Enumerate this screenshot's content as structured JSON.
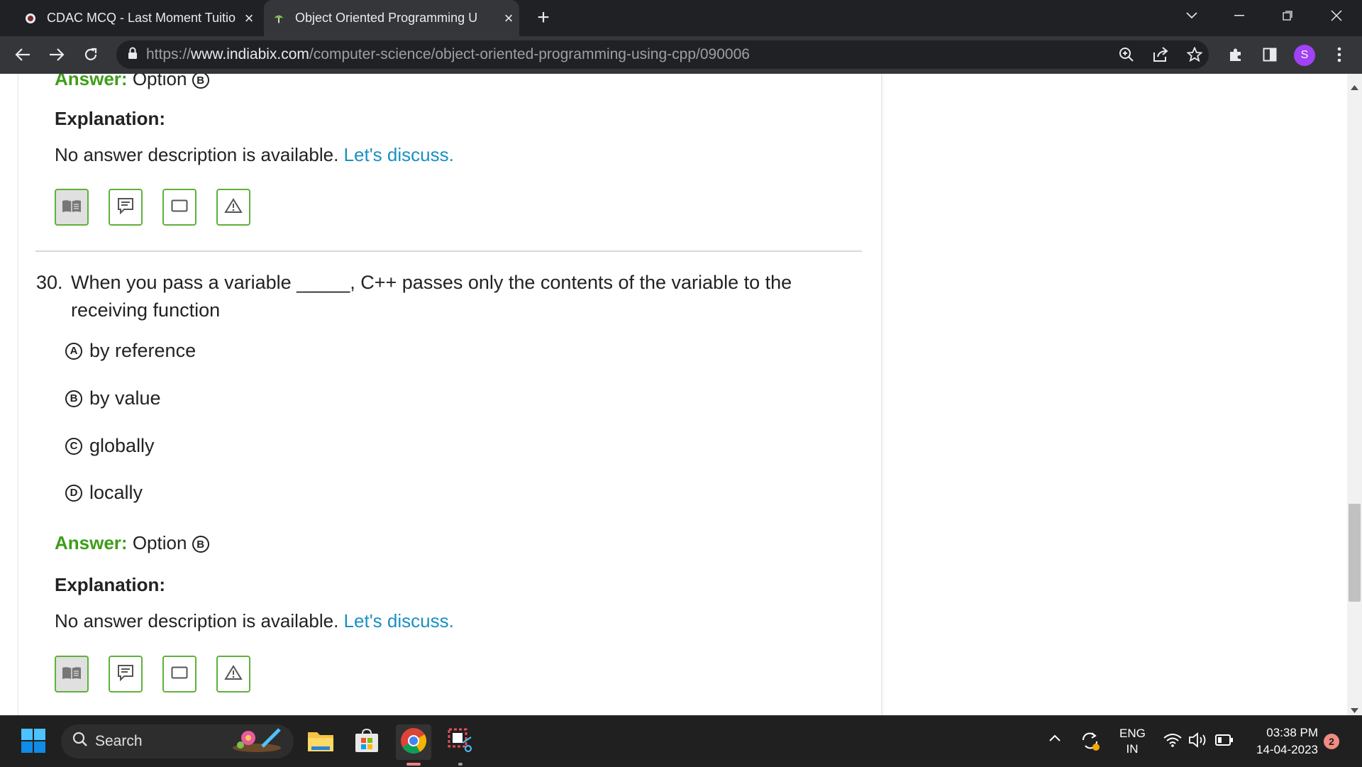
{
  "browser": {
    "tabs": [
      {
        "title": "CDAC MCQ - Last Moment Tuitio",
        "active": false
      },
      {
        "title": "Object Oriented Programming U",
        "active": true
      }
    ],
    "url_prefix": "https://",
    "url_host": "www.indiabix.com",
    "url_path": "/computer-science/object-oriented-programming-using-cpp/090006",
    "profile_initial": "S"
  },
  "prev_question": {
    "answer_label": "Answer:",
    "answer_text": "Option",
    "answer_letter": "B",
    "explanation_label": "Explanation:",
    "explanation_text": "No answer description is available.",
    "discuss_link": "Let's discuss."
  },
  "question": {
    "number": "30.",
    "text_line1": "When you pass a variable _____, C++ passes only the contents of the variable to the",
    "text_line2": "receiving function",
    "options": [
      {
        "letter": "A",
        "text": "by reference"
      },
      {
        "letter": "B",
        "text": "by value"
      },
      {
        "letter": "C",
        "text": "globally"
      },
      {
        "letter": "D",
        "text": "locally"
      }
    ],
    "answer_label": "Answer:",
    "answer_text": "Option",
    "answer_letter": "B",
    "explanation_label": "Explanation:",
    "explanation_text": "No answer description is available.",
    "discuss_link": "Let's discuss."
  },
  "action_icons": [
    "book-icon",
    "comment-icon",
    "workspace-icon",
    "report-icon"
  ],
  "taskbar": {
    "search_label": "Search",
    "lang_top": "ENG",
    "lang_bottom": "IN",
    "time": "03:38 PM",
    "date": "14-04-2023",
    "notification_count": "2"
  },
  "colors": {
    "accent_green": "#3e9d1a",
    "link_blue": "#1a8fc4",
    "chrome_dark": "#202124",
    "chrome_toolbar": "#35363a"
  }
}
